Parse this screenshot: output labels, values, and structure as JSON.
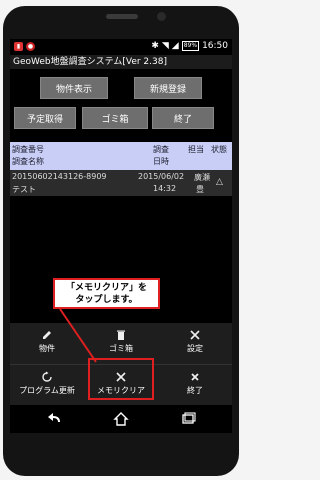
{
  "status_bar": {
    "battery": "89%",
    "time": "16:50"
  },
  "app_title": "GeoWeb地盤調査システム[Ver 2.38]",
  "buttons": {
    "bukken": "物件表示",
    "new": "新規登録",
    "yotei": "予定取得",
    "trash": "ゴミ箱",
    "exit": "終了"
  },
  "table": {
    "headers": {
      "id": "調査番号",
      "name": "調査名称",
      "date1": "調査",
      "date2": "日時",
      "tanto": "担当",
      "status": "状態"
    },
    "row": {
      "id": "20150602143126-8909",
      "name": "テスト",
      "date": "2015/06/02",
      "time": "14:32",
      "tanto1": "廣瀬",
      "tanto2": "豊",
      "status_icon": "△"
    }
  },
  "menu": {
    "bukken": "物件",
    "trash": "ゴミ箱",
    "settings": "設定",
    "program_update": "プログラム更新",
    "memory_clear": "メモリクリア",
    "exit": "終了"
  },
  "callout": {
    "line1": "「メモリクリア」を",
    "line2": "タップします。"
  },
  "colors": {
    "accent": "#e02020",
    "header_bg": "#c8cef5"
  }
}
